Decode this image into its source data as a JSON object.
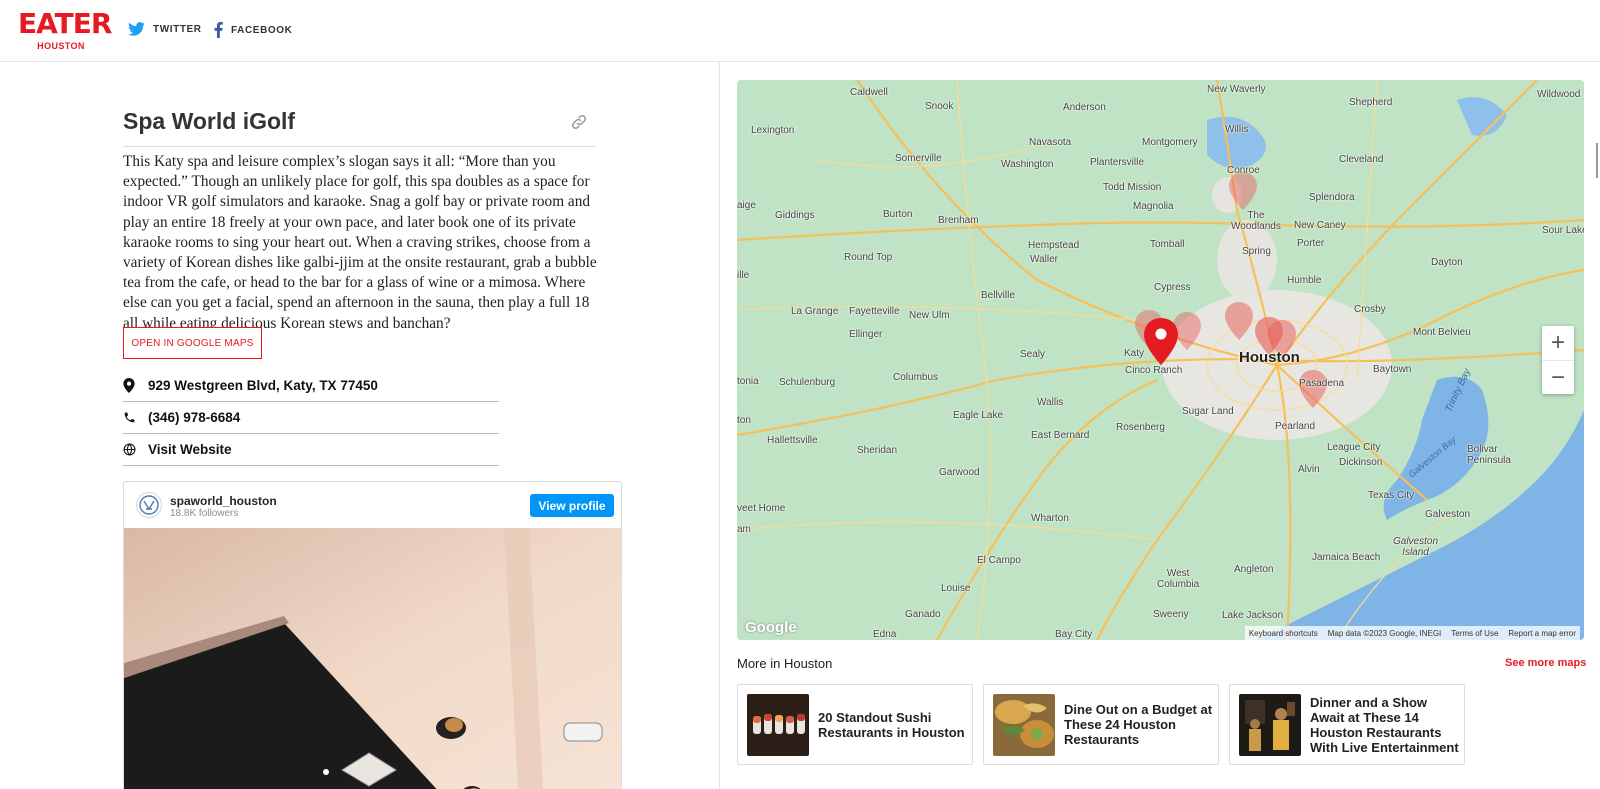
{
  "header": {
    "logo_main": "EATER",
    "logo_sub": "HOUSTON",
    "twitter_label": "TWITTER",
    "facebook_label": "FACEBOOK"
  },
  "place": {
    "title": "Spa World iGolf",
    "description": "This Katy spa and leisure complex’s slogan says it all: “More than you expected.” Though an unlikely place for golf, this spa doubles as a space for indoor VR golf simulators and karaoke. Snag a golf bay or private room and play an entire 18 freely at your own pace, and later book one of its private karaoke rooms to sing your heart out. When a craving strikes, choose from a variety of Korean dishes like galbi-jjim at the onsite restaurant, grab a bubble tea from the cafe, or head to the bar for a glass of wine or a mimosa. Where else can you get a facial, spend an afternoon in the sauna, then play a full 18 all while eating delicious Korean stews and banchan?",
    "google_maps_button": "OPEN IN GOOGLE MAPS",
    "address": "929 Westgreen Blvd, Katy, TX 77450",
    "phone": "(346) 978-6684",
    "website": "Visit Website"
  },
  "instagram": {
    "username": "spaworld_houston",
    "followers": "18.8K followers",
    "view_profile": "View profile"
  },
  "map": {
    "labels": {
      "caldwell": "Caldwell",
      "snook": "Snook",
      "anderson": "Anderson",
      "new_waverly": "New Waverly",
      "shepherd": "Shepherd",
      "wildwood": "Wildwood",
      "lexington": "Lexington",
      "willis": "Willis",
      "navasota": "Navasota",
      "montgomery": "Montgomery",
      "somerville": "Somerville",
      "washington": "Washington",
      "plantersville": "Plantersville",
      "cleveland": "Cleveland",
      "conroe": "Conroe",
      "todd_mission": "Todd Mission",
      "splendora": "Splendora",
      "giddings_pre": "aige",
      "giddings": "Giddings",
      "burton": "Burton",
      "brenham": "Brenham",
      "magnolia": "Magnolia",
      "the_woodlands": "The\nWoodlands",
      "new_caney": "New Caney",
      "sour_lake": "Sour Lake",
      "hempstead": "Hempstead",
      "tomball": "Tomball",
      "spring": "Spring",
      "porter": "Porter",
      "round_top": "Round Top",
      "waller": "Waller",
      "dayton": "Dayton",
      "ille": "ille",
      "humble": "Humble",
      "cypress": "Cypress",
      "la_grange": "La Grange",
      "fayetteville": "Fayetteville",
      "bellville": "Bellville",
      "crosby": "Crosby",
      "new_ulm": "New Ulm",
      "ellinger": "Ellinger",
      "mont_belvieu": "Mont Belvieu",
      "sealy": "Sealy",
      "katy": "Katy",
      "houston": "Houston",
      "tonia": "tonia",
      "schulenburg": "Schulenburg",
      "columbus": "Columbus",
      "cinco_ranch": "Cinco Ranch",
      "baytown": "Baytown",
      "pasadena": "Pasadena",
      "trinity_bay": "Trinity Bay",
      "wallis": "Wallis",
      "ton": "ton",
      "eagle_lake": "Eagle Lake",
      "sugar_land": "Sugar Land",
      "pearland": "Pearland",
      "rosenberg": "Rosenberg",
      "east_bernard": "East Bernard",
      "league_city": "League City",
      "hallettsville": "Hallettsville",
      "sheridan": "Sheridan",
      "dickinson": "Dickinson",
      "bolivar": "Bolivar\nPeninsula",
      "galveston_bay": "Galveston Bay",
      "alvin": "Alvin",
      "garwood": "Garwood",
      "texas_city": "Texas City",
      "veet_home": "veet Home",
      "galveston": "Galveston",
      "am": "am",
      "wharton": "Wharton",
      "galveston_island": "Galveston\nIsland",
      "jamaica_beach": "Jamaica Beach",
      "el_campo": "El Campo",
      "west_columbia": "West\nColumbia",
      "angleton": "Angleton",
      "louise": "Louise",
      "ganado": "Ganado",
      "sweeny": "Sweeny",
      "lake_jackson": "Lake Jackson",
      "edna": "Edna",
      "bay_city": "Bay City"
    },
    "google": "Google",
    "attribution": [
      "Keyboard shortcuts",
      "Map data ©2023 Google, INEGI",
      "Terms of Use",
      "Report a map error"
    ],
    "zoom_in": "+",
    "zoom_out": "−",
    "colors": {
      "land": "#bfe3c4",
      "water": "#7fb4e6",
      "road": "#f5c05a",
      "urban": "#e8e6e1",
      "pin": "#e41b23"
    }
  },
  "more": {
    "title": "More in Houston",
    "see_more": "See more maps",
    "cards": [
      {
        "title": "20 Standout Sushi Restaurants in Houston"
      },
      {
        "title": "Dine Out on a Budget at These 24 Houston Restaurants"
      },
      {
        "title": "Dinner and a Show Await at These 14 Houston Restaurants With Live Entertainment"
      }
    ]
  }
}
